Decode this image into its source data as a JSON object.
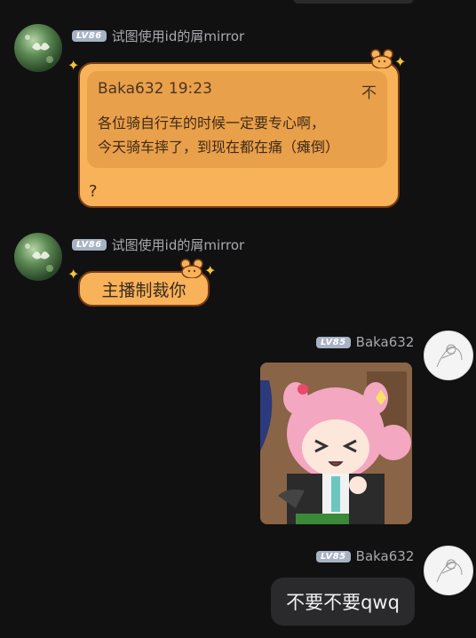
{
  "messages": [
    {
      "sender": "试图使用id的屑mirror",
      "level": "LV86",
      "quote": {
        "author_time": "Baka632 19:23",
        "close_glyph": "不",
        "text_line1": "各位骑自行车的时候一定要专心啊，",
        "text_line2": "今天骑车摔了，到现在都在痛（瘫倒）"
      },
      "text": "?"
    },
    {
      "sender": "试图使用id的屑mirror",
      "level": "LV86",
      "text": "主播制裁你"
    },
    {
      "sender": "Baka632",
      "level": "LV85",
      "type": "sticker"
    },
    {
      "sender": "Baka632",
      "level": "LV85",
      "text": "不要不要qwq"
    }
  ],
  "colors": {
    "background": "#111112",
    "bubble_orange": "#f8b25a",
    "bubble_dark": "#2a2a2c",
    "level_badge": "#a7b2c4"
  }
}
